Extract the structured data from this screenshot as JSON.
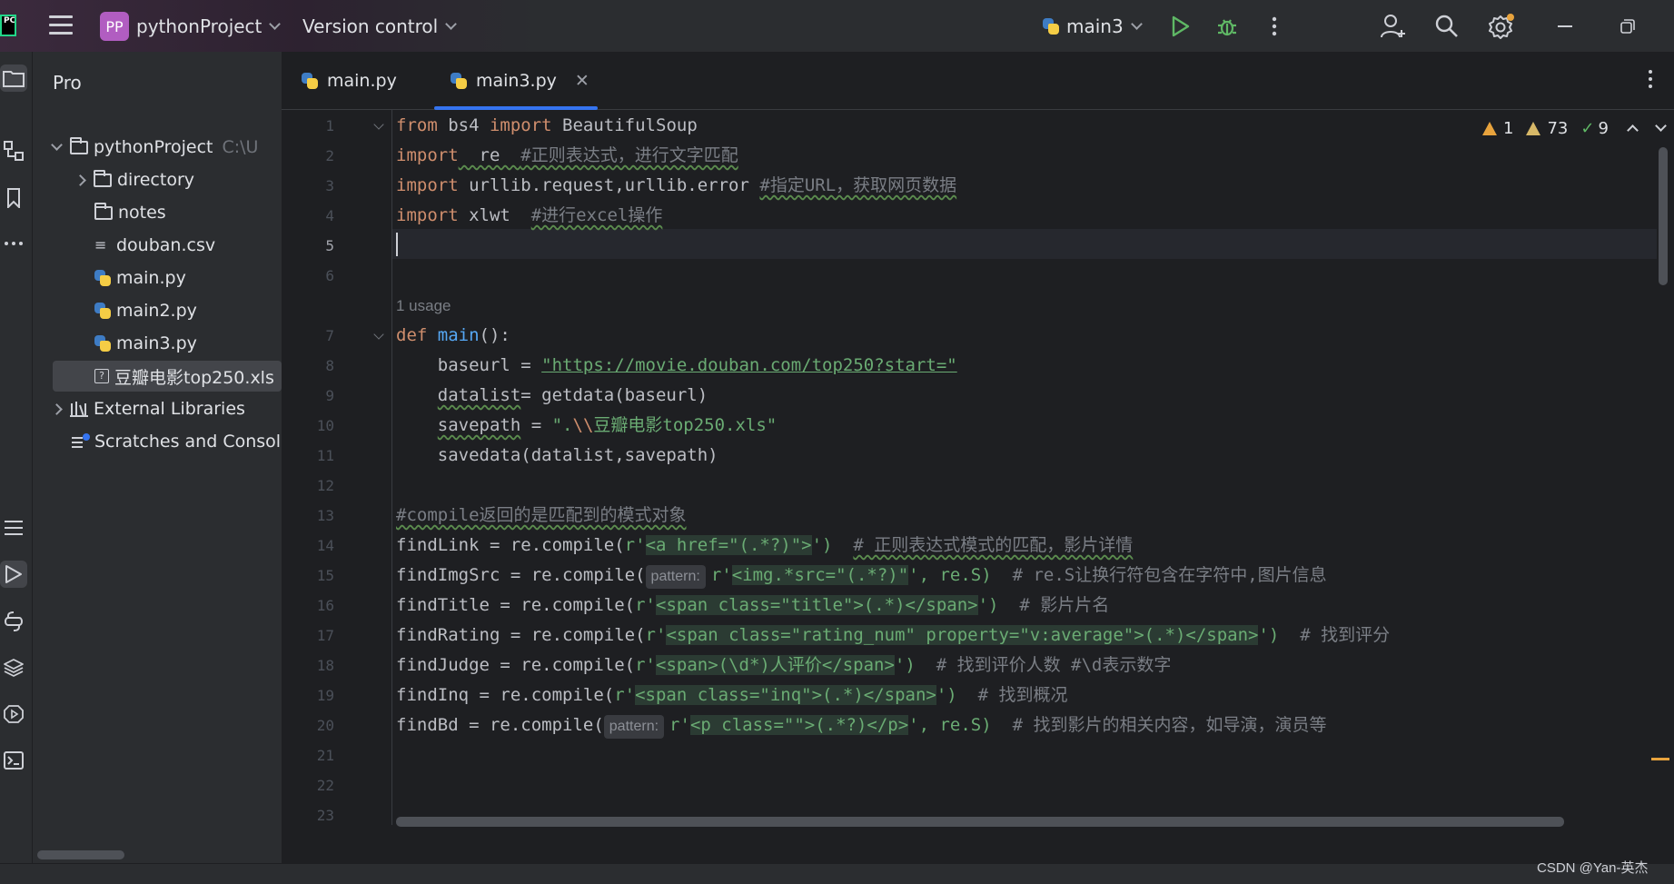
{
  "titlebar": {
    "ide_logo": "PC",
    "project_badge": "PP",
    "project_name": "pythonProject",
    "version_control": "Version control",
    "run_config": "main3"
  },
  "project_pane": {
    "title": "Pro",
    "root": {
      "name": "pythonProject",
      "path": "C:\\U"
    },
    "items": [
      {
        "name": "directory",
        "kind": "folder"
      },
      {
        "name": "notes",
        "kind": "folder"
      },
      {
        "name": "douban.csv",
        "kind": "text"
      },
      {
        "name": "main.py",
        "kind": "python"
      },
      {
        "name": "main2.py",
        "kind": "python"
      },
      {
        "name": "main3.py",
        "kind": "python"
      },
      {
        "name": "豆瓣电影top250.xls",
        "kind": "unknown"
      }
    ],
    "external_libraries": "External Libraries",
    "scratches": "Scratches and Consoles"
  },
  "tabs": [
    {
      "label": "main.py",
      "active": false
    },
    {
      "label": "main3.py",
      "active": true
    }
  ],
  "inspections": {
    "errors": "1",
    "warnings": "73",
    "ok": "9"
  },
  "editor": {
    "caret_line": 5,
    "usage_hint": "1 usage",
    "param_hint": "pattern:",
    "lines": {
      "l1": {
        "kw1": "from",
        "t1": " bs4 ",
        "kw2": "import",
        "t2": " BeautifulSoup"
      },
      "l2": {
        "kw": "import",
        "t": "  re  ",
        "cm": "#正则表达式，进行文字匹配"
      },
      "l3": {
        "kw": "import",
        "t": " urllib.request,urllib.error ",
        "cm": "#指定URL，获取网页数据"
      },
      "l4": {
        "kw": "import",
        "t": " xlwt  ",
        "cm": "#进行excel操作"
      },
      "l7": {
        "kw": "def",
        "fn": "main",
        "t": "():"
      },
      "l8": {
        "t": "    baseurl = ",
        "str": "\"https://movie.douban.com/top250?start=\""
      },
      "l9": {
        "var": "datalist",
        "t": "= getdata(baseurl)"
      },
      "l10": {
        "var": "savepath",
        "t": " = ",
        "s1": "\".",
        "esc": "\\\\",
        "s2": "豆瓣电影top250.xls\""
      },
      "l11": {
        "t": "    savedata(datalist,savepath)"
      },
      "l13": {
        "cm": "#compile返回的是匹配到的模式对象"
      },
      "l14": {
        "t": "findLink = re.compile(",
        "r": "r'",
        "rx": "<a href=\"(.*?)\">",
        "e": "')",
        "cm": "# 正则表达式模式的匹配，影片详情"
      },
      "l15": {
        "t": "findImgSrc = re.compile(",
        "r": "r'",
        "rx": "<img.*src=\"(.*?)\"",
        "e": "', re.S)",
        "cm": "# re.S让换行符包含在字符中,图片信息"
      },
      "l16": {
        "t": "findTitle = re.compile(",
        "r": "r'",
        "rx": "<span class=\"title\">(.*)</span>",
        "e": "')",
        "cm": "# 影片片名"
      },
      "l17": {
        "t": "findRating = re.compile(",
        "r": "r'",
        "rx": "<span class=\"rating_num\" property=\"v:average\">(.*)</span>",
        "e": "')",
        "cm": "# 找到评分"
      },
      "l18": {
        "t": "findJudge = re.compile(",
        "r": "r'",
        "rx": "<span>(\\d*)人评价</span>",
        "e": "')",
        "cm": "# 找到评价人数 #\\d表示数字"
      },
      "l19": {
        "t": "findInq = re.compile(",
        "r": "r'",
        "rx": "<span class=\"inq\">(.*)</span>",
        "e": "')",
        "cm": "# 找到概况"
      },
      "l20": {
        "t": "findBd = re.compile(",
        "r": "r'",
        "rx": "<p class=\"\">(.*?)</p>",
        "e": "', re.S)",
        "cm": "# 找到影片的相关内容，如导演，演员等"
      }
    }
  },
  "line_numbers": [
    "1",
    "2",
    "3",
    "4",
    "5",
    "6",
    "7",
    "8",
    "9",
    "10",
    "11",
    "12",
    "13",
    "14",
    "15",
    "16",
    "17",
    "18",
    "19",
    "20",
    "21",
    "22",
    "23"
  ],
  "watermark": "CSDN @Yan-英杰",
  "colors": {
    "keyword": "#cf8e6d",
    "string": "#6aab73",
    "comment": "#7a7e85",
    "function": "#56a8f5",
    "accent": "#3574f0"
  }
}
